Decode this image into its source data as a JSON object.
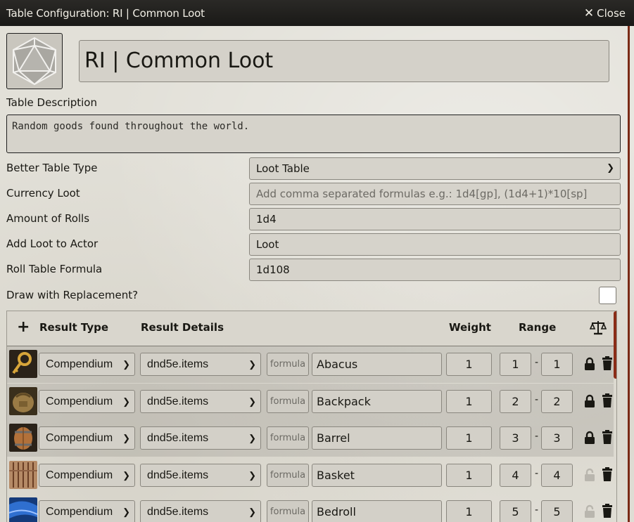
{
  "window": {
    "title": "Table Configuration: RI | Common Loot",
    "close_label": "Close"
  },
  "table_name": "RI | Common Loot",
  "description": {
    "label": "Table Description",
    "value": "Random goods found throughout the world."
  },
  "settings": {
    "table_type": {
      "label": "Better Table Type",
      "value": "Loot Table"
    },
    "currency_loot": {
      "label": "Currency Loot",
      "placeholder": "Add comma separated formulas e.g.: 1d4[gp], (1d4+1)*10[sp]"
    },
    "amount_of_rolls": {
      "label": "Amount of Rolls",
      "value": "1d4"
    },
    "add_loot_to_actor": {
      "label": "Add Loot to Actor",
      "value": "Loot"
    },
    "roll_table_formula": {
      "label": "Roll Table Formula",
      "value": "1d108"
    },
    "draw_with_replacement": {
      "label": "Draw with Replacement?",
      "checked": false
    }
  },
  "results": {
    "headers": {
      "result_type": "Result Type",
      "result_details": "Result Details",
      "weight": "Weight",
      "range": "Range"
    },
    "rows": [
      {
        "type": "Compendium",
        "collection": "dnd5e.items",
        "formula_placeholder": "formula",
        "name": "Abacus",
        "weight": "1",
        "range_low": "1",
        "range_high": "1",
        "locked": true,
        "icon": "abacus-icon"
      },
      {
        "type": "Compendium",
        "collection": "dnd5e.items",
        "formula_placeholder": "formula",
        "name": "Backpack",
        "weight": "1",
        "range_low": "2",
        "range_high": "2",
        "locked": true,
        "icon": "backpack-icon"
      },
      {
        "type": "Compendium",
        "collection": "dnd5e.items",
        "formula_placeholder": "formula",
        "name": "Barrel",
        "weight": "1",
        "range_low": "3",
        "range_high": "3",
        "locked": true,
        "icon": "barrel-icon"
      },
      {
        "type": "Compendium",
        "collection": "dnd5e.items",
        "formula_placeholder": "formula",
        "name": "Basket",
        "weight": "1",
        "range_low": "4",
        "range_high": "4",
        "locked": false,
        "icon": "basket-icon"
      },
      {
        "type": "Compendium",
        "collection": "dnd5e.items",
        "formula_placeholder": "formula",
        "name": "Bedroll",
        "weight": "1",
        "range_low": "5",
        "range_high": "5",
        "locked": false,
        "icon": "bedroll-icon"
      }
    ]
  },
  "colors": {
    "titlebar": "#1a1917",
    "accent": "#8a2c17",
    "panel": "#e2e0d8"
  }
}
